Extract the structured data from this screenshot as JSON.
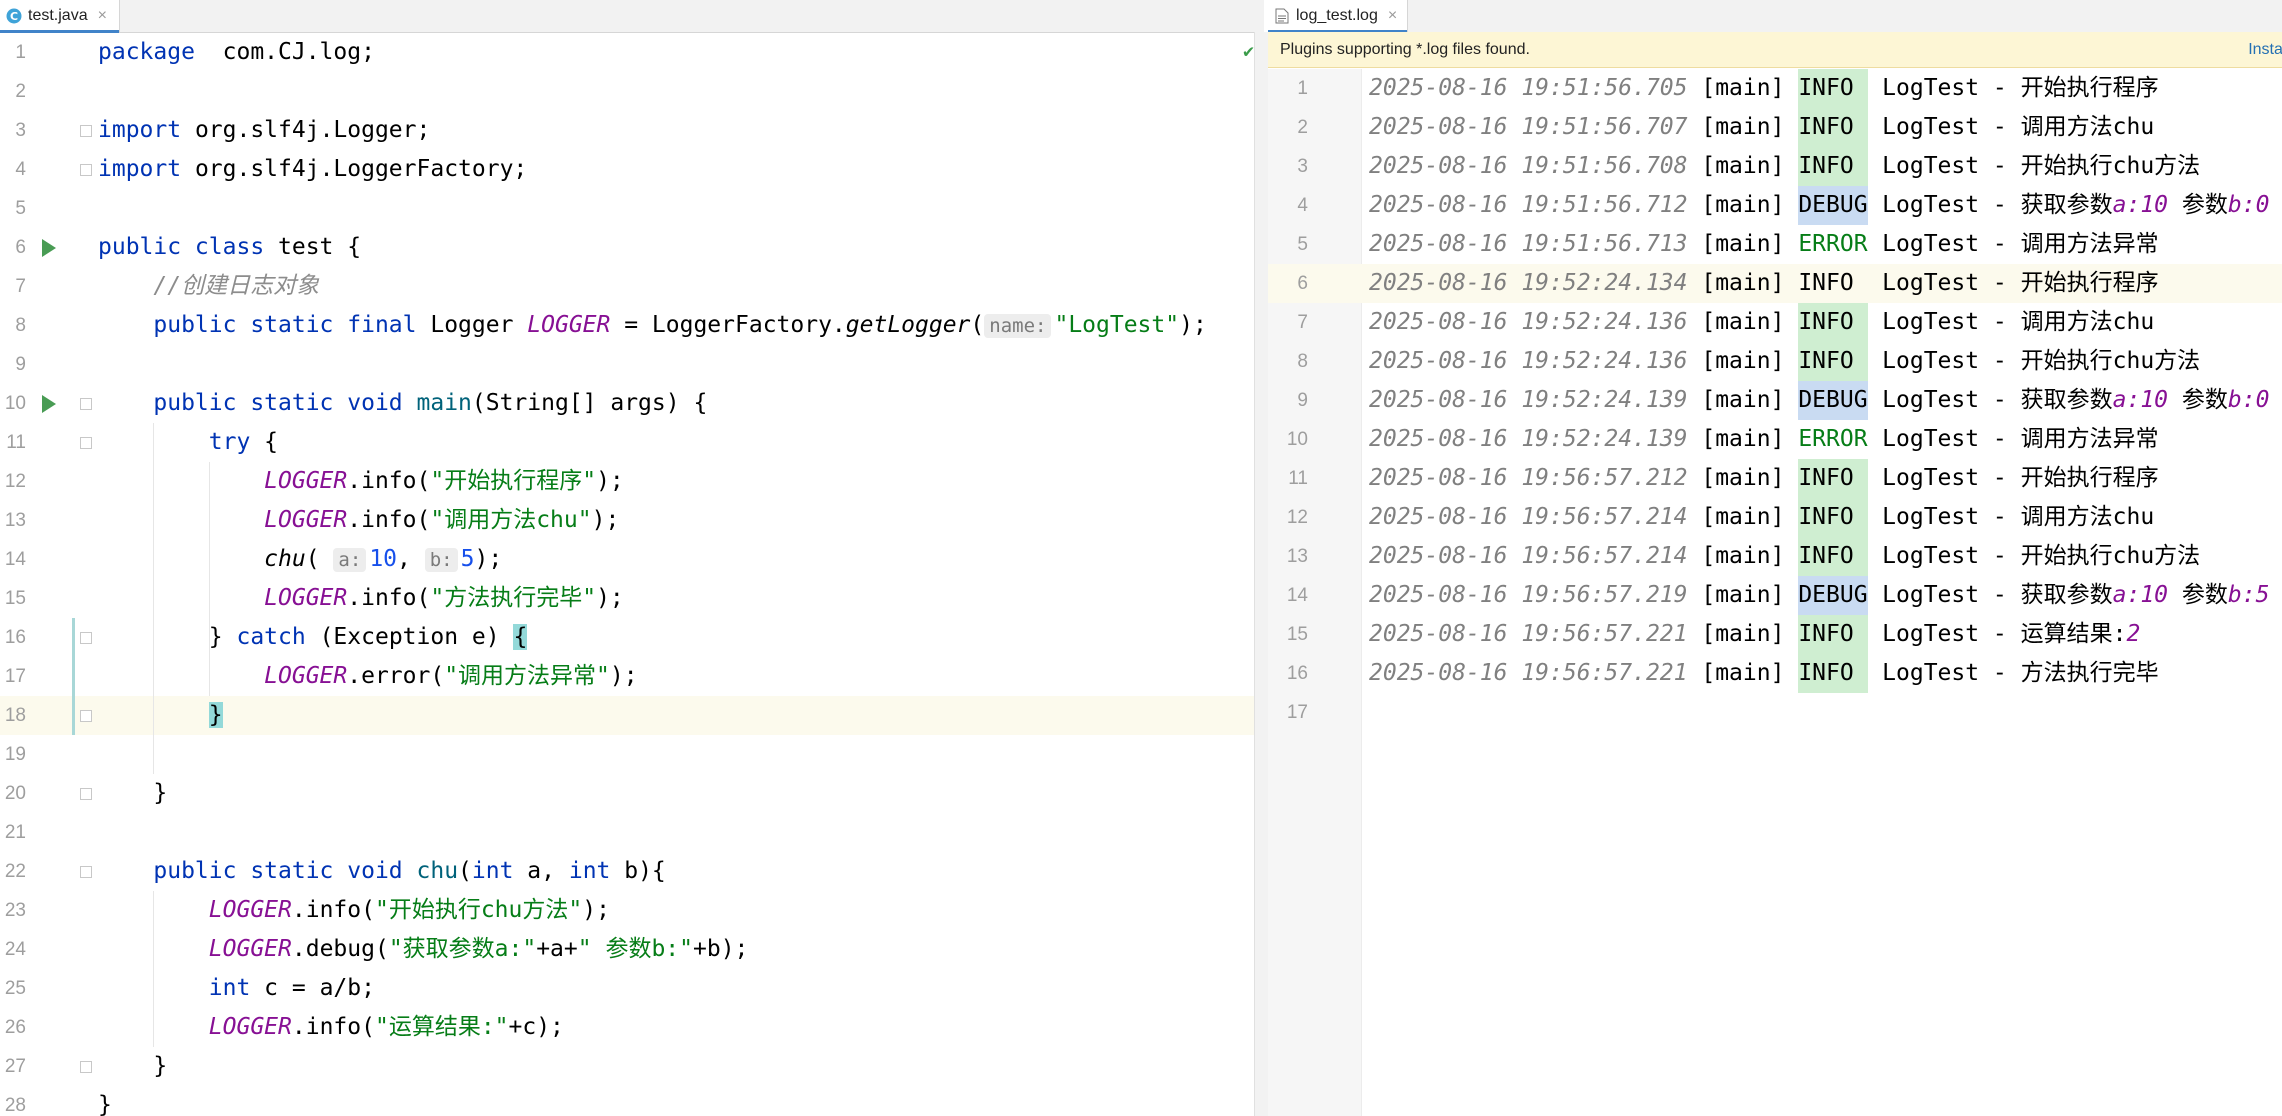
{
  "left_tab": {
    "label": "test.java",
    "icon": "java-class-icon",
    "close": "×"
  },
  "right_tab": {
    "label": "log_test.log",
    "icon": "log-file-icon",
    "close": "×"
  },
  "banner": {
    "message": "Plugins supporting *.log files found.",
    "action": "Install"
  },
  "java_lines": [
    {
      "n": "1",
      "t": [
        [
          "kw",
          "package"
        ],
        [
          "",
          "  com.CJ.log;"
        ]
      ]
    },
    {
      "n": "2",
      "t": []
    },
    {
      "n": "3",
      "t": [
        [
          "kw",
          "import"
        ],
        [
          "",
          " org.slf4j.Logger;"
        ]
      ]
    },
    {
      "n": "4",
      "t": [
        [
          "kw",
          "import"
        ],
        [
          "",
          " org.slf4j.LoggerFactory;"
        ]
      ]
    },
    {
      "n": "5",
      "t": []
    },
    {
      "n": "6",
      "t": [
        [
          "kw",
          "public class"
        ],
        [
          "",
          " test {"
        ]
      ]
    },
    {
      "n": "7",
      "t": [
        [
          "",
          "    "
        ],
        [
          "cm",
          "//创建日志对象"
        ]
      ]
    },
    {
      "n": "8",
      "t": [
        [
          "",
          "    "
        ],
        [
          "kw",
          "public static final"
        ],
        [
          "",
          " Logger "
        ],
        [
          "cn",
          "LOGGER"
        ],
        [
          "",
          " = LoggerFactory."
        ],
        [
          "mi",
          "getLogger"
        ],
        [
          "",
          "("
        ],
        [
          "hint",
          "name:"
        ],
        [
          "st",
          "\"LogTest\""
        ],
        [
          "",
          ");"
        ]
      ]
    },
    {
      "n": "9",
      "t": []
    },
    {
      "n": "10",
      "t": [
        [
          "",
          "    "
        ],
        [
          "kw",
          "public static void"
        ],
        [
          "",
          " "
        ],
        [
          "fn",
          "main"
        ],
        [
          "",
          "(String[] args) {"
        ]
      ]
    },
    {
      "n": "11",
      "t": [
        [
          "",
          "        "
        ],
        [
          "kw",
          "try"
        ],
        [
          "",
          " {"
        ]
      ]
    },
    {
      "n": "12",
      "t": [
        [
          "",
          "            "
        ],
        [
          "cn",
          "LOGGER"
        ],
        [
          "",
          ".info("
        ],
        [
          "st",
          "\"开始执行程序\""
        ],
        [
          "",
          ");"
        ]
      ]
    },
    {
      "n": "13",
      "t": [
        [
          "",
          "            "
        ],
        [
          "cn",
          "LOGGER"
        ],
        [
          "",
          ".info("
        ],
        [
          "st",
          "\"调用方法chu\""
        ],
        [
          "",
          ");"
        ]
      ]
    },
    {
      "n": "14",
      "t": [
        [
          "",
          "            "
        ],
        [
          "mi",
          "chu"
        ],
        [
          "",
          "( "
        ],
        [
          "hint",
          "a:"
        ],
        [
          "num",
          "10"
        ],
        [
          "",
          ", "
        ],
        [
          "hint",
          "b:"
        ],
        [
          "num",
          "5"
        ],
        [
          "",
          ");"
        ]
      ]
    },
    {
      "n": "15",
      "t": [
        [
          "",
          "            "
        ],
        [
          "cn",
          "LOGGER"
        ],
        [
          "",
          ".info("
        ],
        [
          "st",
          "\"方法执行完毕\""
        ],
        [
          "",
          ");"
        ]
      ]
    },
    {
      "n": "16",
      "t": [
        [
          "",
          "        } "
        ],
        [
          "kw",
          "catch"
        ],
        [
          "",
          " (Exception e) "
        ],
        [
          "brace-hl",
          "{"
        ]
      ]
    },
    {
      "n": "17",
      "t": [
        [
          "",
          "            "
        ],
        [
          "cn",
          "LOGGER"
        ],
        [
          "",
          ".error("
        ],
        [
          "st",
          "\"调用方法异常\""
        ],
        [
          "",
          ");"
        ]
      ]
    },
    {
      "n": "18",
      "t": [
        [
          "",
          "        "
        ],
        [
          "brace-hl",
          "}"
        ]
      ]
    },
    {
      "n": "19",
      "t": []
    },
    {
      "n": "20",
      "t": [
        [
          "",
          "    }"
        ]
      ]
    },
    {
      "n": "21",
      "t": []
    },
    {
      "n": "22",
      "t": [
        [
          "",
          "    "
        ],
        [
          "kw",
          "public static void"
        ],
        [
          "",
          " "
        ],
        [
          "fn",
          "chu"
        ],
        [
          "",
          "("
        ],
        [
          "kw",
          "int"
        ],
        [
          "",
          " a, "
        ],
        [
          "kw",
          "int"
        ],
        [
          "",
          " b){"
        ]
      ]
    },
    {
      "n": "23",
      "t": [
        [
          "",
          "        "
        ],
        [
          "cn",
          "LOGGER"
        ],
        [
          "",
          ".info("
        ],
        [
          "st",
          "\"开始执行chu方法\""
        ],
        [
          "",
          ");"
        ]
      ]
    },
    {
      "n": "24",
      "t": [
        [
          "",
          "        "
        ],
        [
          "cn",
          "LOGGER"
        ],
        [
          "",
          ".debug("
        ],
        [
          "st",
          "\"获取参数a:\""
        ],
        [
          "",
          "+a+"
        ],
        [
          "st",
          "\" 参数b:\""
        ],
        [
          "",
          "+b);"
        ]
      ]
    },
    {
      "n": "25",
      "t": [
        [
          "",
          "        "
        ],
        [
          "kw",
          "int"
        ],
        [
          "",
          " c = a/b;"
        ]
      ]
    },
    {
      "n": "26",
      "t": [
        [
          "",
          "        "
        ],
        [
          "cn",
          "LOGGER"
        ],
        [
          "",
          ".info("
        ],
        [
          "st",
          "\"运算结果:\""
        ],
        [
          "",
          "+c);"
        ]
      ]
    },
    {
      "n": "27",
      "t": [
        [
          "",
          "    }"
        ]
      ]
    },
    {
      "n": "28",
      "t": [
        [
          "",
          "}"
        ]
      ]
    }
  ],
  "log_lines": [
    {
      "n": "1",
      "ts": "2025-08-16 19:51:56.705",
      "thr": "[main]",
      "lvl": "INFO",
      "lvlstyle": "info",
      "msg": [
        [
          "lg",
          " LogTest - 开始执行程序"
        ]
      ]
    },
    {
      "n": "2",
      "ts": "2025-08-16 19:51:56.707",
      "thr": "[main]",
      "lvl": "INFO",
      "lvlstyle": "info",
      "msg": [
        [
          "lg",
          " LogTest - 调用方法chu"
        ]
      ]
    },
    {
      "n": "3",
      "ts": "2025-08-16 19:51:56.708",
      "thr": "[main]",
      "lvl": "INFO",
      "lvlstyle": "info",
      "msg": [
        [
          "lg",
          " LogTest - 开始执行chu方法"
        ]
      ]
    },
    {
      "n": "4",
      "ts": "2025-08-16 19:51:56.712",
      "thr": "[main]",
      "lvl": "DEBUG",
      "lvlstyle": "debug",
      "msg": [
        [
          "lg",
          " LogTest - 获取参数"
        ],
        [
          "argv",
          "a:10"
        ],
        [
          "lg",
          " 参数"
        ],
        [
          "argv",
          "b:0"
        ]
      ]
    },
    {
      "n": "5",
      "ts": "2025-08-16 19:51:56.713",
      "thr": "[main]",
      "lvl": "ERROR",
      "lvlstyle": "error",
      "msg": [
        [
          "lg",
          " LogTest - 调用方法异常"
        ]
      ]
    },
    {
      "n": "6",
      "ts": "2025-08-16 19:52:24.134",
      "thr": "[main]",
      "lvl": "INFO",
      "lvlstyle": "plain",
      "msg": [
        [
          "lg",
          " LogTest - 开始执行程序"
        ]
      ]
    },
    {
      "n": "7",
      "ts": "2025-08-16 19:52:24.136",
      "thr": "[main]",
      "lvl": "INFO",
      "lvlstyle": "info",
      "msg": [
        [
          "lg",
          " LogTest - 调用方法chu"
        ]
      ]
    },
    {
      "n": "8",
      "ts": "2025-08-16 19:52:24.136",
      "thr": "[main]",
      "lvl": "INFO",
      "lvlstyle": "info",
      "msg": [
        [
          "lg",
          " LogTest - 开始执行chu方法"
        ]
      ]
    },
    {
      "n": "9",
      "ts": "2025-08-16 19:52:24.139",
      "thr": "[main]",
      "lvl": "DEBUG",
      "lvlstyle": "debug",
      "msg": [
        [
          "lg",
          " LogTest - 获取参数"
        ],
        [
          "argv",
          "a:10"
        ],
        [
          "lg",
          " 参数"
        ],
        [
          "argv",
          "b:0"
        ]
      ]
    },
    {
      "n": "10",
      "ts": "2025-08-16 19:52:24.139",
      "thr": "[main]",
      "lvl": "ERROR",
      "lvlstyle": "error",
      "msg": [
        [
          "lg",
          " LogTest - 调用方法异常"
        ]
      ]
    },
    {
      "n": "11",
      "ts": "2025-08-16 19:56:57.212",
      "thr": "[main]",
      "lvl": "INFO",
      "lvlstyle": "info",
      "msg": [
        [
          "lg",
          " LogTest - 开始执行程序"
        ]
      ]
    },
    {
      "n": "12",
      "ts": "2025-08-16 19:56:57.214",
      "thr": "[main]",
      "lvl": "INFO",
      "lvlstyle": "info",
      "msg": [
        [
          "lg",
          " LogTest - 调用方法chu"
        ]
      ]
    },
    {
      "n": "13",
      "ts": "2025-08-16 19:56:57.214",
      "thr": "[main]",
      "lvl": "INFO",
      "lvlstyle": "info",
      "msg": [
        [
          "lg",
          " LogTest - 开始执行chu方法"
        ]
      ]
    },
    {
      "n": "14",
      "ts": "2025-08-16 19:56:57.219",
      "thr": "[main]",
      "lvl": "DEBUG",
      "lvlstyle": "debug",
      "msg": [
        [
          "lg",
          " LogTest - 获取参数"
        ],
        [
          "argv",
          "a:10"
        ],
        [
          "lg",
          " 参数"
        ],
        [
          "argv",
          "b:5"
        ]
      ]
    },
    {
      "n": "15",
      "ts": "2025-08-16 19:56:57.221",
      "thr": "[main]",
      "lvl": "INFO",
      "lvlstyle": "info",
      "msg": [
        [
          "lg",
          " LogTest - 运算结果:"
        ],
        [
          "argv",
          "2"
        ]
      ]
    },
    {
      "n": "16",
      "ts": "2025-08-16 19:56:57.221",
      "thr": "[main]",
      "lvl": "INFO",
      "lvlstyle": "info",
      "msg": [
        [
          "lg",
          " LogTest - 方法执行完毕"
        ]
      ]
    },
    {
      "n": "17",
      "ts": "",
      "thr": "",
      "lvl": "",
      "lvlstyle": "",
      "msg": []
    }
  ],
  "status": {
    "inspection": "✔"
  },
  "colors": {
    "keyword": "#0033b3",
    "constant": "#871094",
    "string": "#067d17",
    "number": "#1750eb",
    "info_bg": "#cfeed1",
    "debug_bg": "#c9dbf2",
    "accent": "#4083c9"
  }
}
